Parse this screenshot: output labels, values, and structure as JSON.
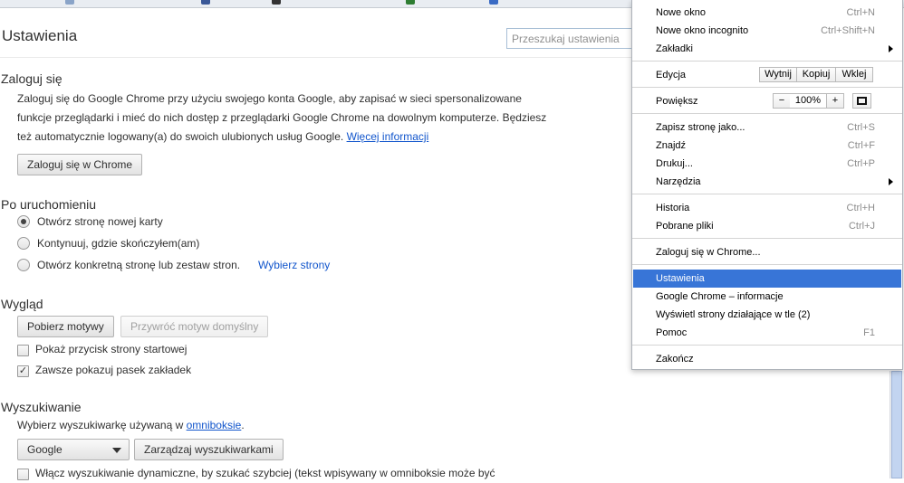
{
  "colors": {
    "link": "#1155cc",
    "menu_selected": "#3875d7"
  },
  "header": {
    "title": "Ustawienia",
    "search_placeholder": "Przeszukaj ustawienia"
  },
  "signin": {
    "heading": "Zaloguj się",
    "line1": "Zaloguj się do Google Chrome przy użyciu swojego konta Google, aby zapisać w sieci spersonalizowane",
    "line2": "funkcje przeglądarki i mieć do nich dostęp z przeglądarki Google Chrome na dowolnym komputerze. Będziesz",
    "line3": "też automatycznie logowany(a) do swoich ulubionych usług Google.",
    "more_link": "Więcej informacji",
    "button": "Zaloguj się w Chrome"
  },
  "startup": {
    "heading": "Po uruchomieniu",
    "options": [
      "Otwórz stronę nowej karty",
      "Kontynuuj, gdzie skończyłem(am)",
      "Otwórz konkretną stronę lub zestaw stron."
    ],
    "selected_index": 0,
    "set_pages_link": "Wybierz strony"
  },
  "appearance": {
    "heading": "Wygląd",
    "get_themes": "Pobierz motywy",
    "reset_theme": "Przywróć motyw domyślny",
    "show_home": "Pokaż przycisk strony startowej",
    "show_home_checked": false,
    "show_bookmarks": "Zawsze pokazuj pasek zakładek",
    "show_bookmarks_checked": true
  },
  "search": {
    "heading": "Wyszukiwanie",
    "desc_prefix": "Wybierz wyszukiwarkę używaną w",
    "omnibox_link": "omniboksie",
    "desc_suffix": ".",
    "engine_selected": "Google",
    "manage_button": "Zarządzaj wyszukiwarkami",
    "instant_label": "Włącz wyszukiwanie dynamiczne, by szukać szybciej (tekst wpisywany w omniboksie może być"
  },
  "menu": {
    "new_window": "Nowe okno",
    "new_window_sc": "Ctrl+N",
    "incognito": "Nowe okno incognito",
    "incognito_sc": "Ctrl+Shift+N",
    "bookmarks": "Zakładki",
    "edit": "Edycja",
    "cut": "Wytnij",
    "copy": "Kopiuj",
    "paste": "Wklej",
    "zoom": "Powiększ",
    "zoom_minus": "−",
    "zoom_value": "100%",
    "zoom_plus": "+",
    "save_page": "Zapisz stronę jako...",
    "save_page_sc": "Ctrl+S",
    "find": "Znajdź",
    "find_sc": "Ctrl+F",
    "print": "Drukuj...",
    "print_sc": "Ctrl+P",
    "tools": "Narzędzia",
    "history": "Historia",
    "history_sc": "Ctrl+H",
    "downloads": "Pobrane pliki",
    "downloads_sc": "Ctrl+J",
    "signin": "Zaloguj się w Chrome...",
    "settings": "Ustawienia",
    "about": "Google Chrome – informacje",
    "background": "Wyświetl strony działające w tle (2)",
    "help": "Pomoc",
    "help_sc": "F1",
    "exit": "Zakończ"
  }
}
